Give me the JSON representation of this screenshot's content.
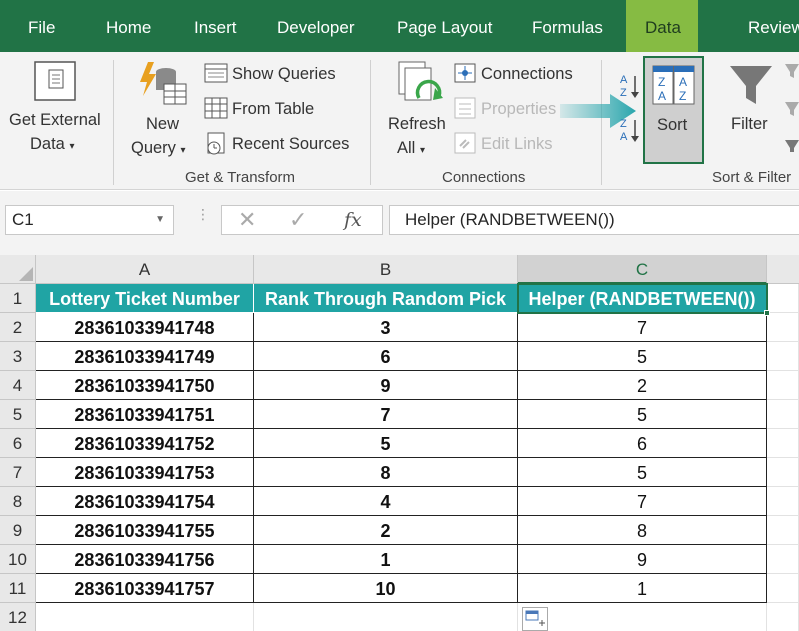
{
  "tabs": [
    "File",
    "Home",
    "Insert",
    "Developer",
    "Page Layout",
    "Formulas",
    "Data",
    "Review"
  ],
  "active_tab": "Data",
  "ribbon": {
    "get_external_data": [
      "Get External",
      "Data"
    ],
    "new_query": [
      "New",
      "Query"
    ],
    "show_queries": "Show Queries",
    "from_table": "From Table",
    "recent_sources": "Recent Sources",
    "get_transform_label": "Get & Transform",
    "refresh_all": [
      "Refresh",
      "All"
    ],
    "connections_btn": "Connections",
    "properties": "Properties",
    "edit_links": "Edit Links",
    "connections_label": "Connections",
    "sort": "Sort",
    "filter": "Filter",
    "sort_filter_label": "Sort & Filter"
  },
  "formula_bar": {
    "name_box": "C1",
    "fx": "fx",
    "formula": "Helper (RANDBETWEEN())"
  },
  "columns": [
    "A",
    "B",
    "C"
  ],
  "rows": [
    "1",
    "2",
    "3",
    "4",
    "5",
    "6",
    "7",
    "8",
    "9",
    "10",
    "11",
    "12"
  ],
  "table": {
    "headers": [
      "Lottery Ticket Number",
      "Rank Through Random Pick",
      "Helper (RANDBETWEEN())"
    ],
    "data": [
      [
        "28361033941748",
        "3",
        "7"
      ],
      [
        "28361033941749",
        "6",
        "5"
      ],
      [
        "28361033941750",
        "9",
        "2"
      ],
      [
        "28361033941751",
        "7",
        "5"
      ],
      [
        "28361033941752",
        "5",
        "6"
      ],
      [
        "28361033941753",
        "8",
        "5"
      ],
      [
        "28361033941754",
        "4",
        "7"
      ],
      [
        "28361033941755",
        "2",
        "8"
      ],
      [
        "28361033941756",
        "1",
        "9"
      ],
      [
        "28361033941757",
        "10",
        "1"
      ]
    ]
  },
  "colors": {
    "excel_green": "#217346",
    "active_tab": "#86bb43",
    "header_teal": "#20a4a4",
    "arrow_teal": "#2aa6ad"
  }
}
